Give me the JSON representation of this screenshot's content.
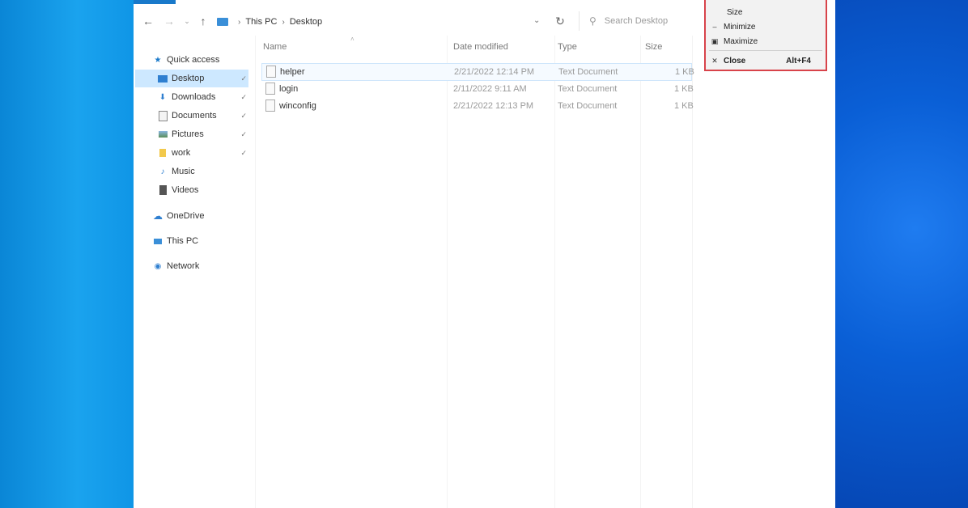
{
  "address": {
    "crumbs": [
      "This PC",
      "Desktop"
    ]
  },
  "search": {
    "placeholder": "Search Desktop"
  },
  "nav": {
    "quick_access": "Quick access",
    "items": [
      {
        "label": "Desktop",
        "icon": "desktop-icon"
      },
      {
        "label": "Downloads",
        "icon": "download-icon"
      },
      {
        "label": "Documents",
        "icon": "documents-icon"
      },
      {
        "label": "Pictures",
        "icon": "pictures-icon"
      },
      {
        "label": "work",
        "icon": "folder-icon"
      },
      {
        "label": "Music",
        "icon": "music-icon"
      },
      {
        "label": "Videos",
        "icon": "videos-icon"
      }
    ],
    "onedrive": "OneDrive",
    "thispc": "This PC",
    "network": "Network"
  },
  "columns": {
    "name": "Name",
    "date": "Date modified",
    "type": "Type",
    "size": "Size"
  },
  "files": [
    {
      "name": "helper",
      "date": "2/21/2022 12:14 PM",
      "type": "Text Document",
      "size": "1 KB"
    },
    {
      "name": "login",
      "date": "2/11/2022 9:11 AM",
      "type": "Text Document",
      "size": "1 KB"
    },
    {
      "name": "winconfig",
      "date": "2/21/2022 12:13 PM",
      "type": "Text Document",
      "size": "1 KB"
    }
  ],
  "system_menu": {
    "size": "Size",
    "minimize": "Minimize",
    "maximize": "Maximize",
    "close": "Close",
    "close_shortcut": "Alt+F4"
  },
  "colors": {
    "accent": "#1979ca",
    "highlight": "#d8434a",
    "selection": "#cde8ff"
  }
}
